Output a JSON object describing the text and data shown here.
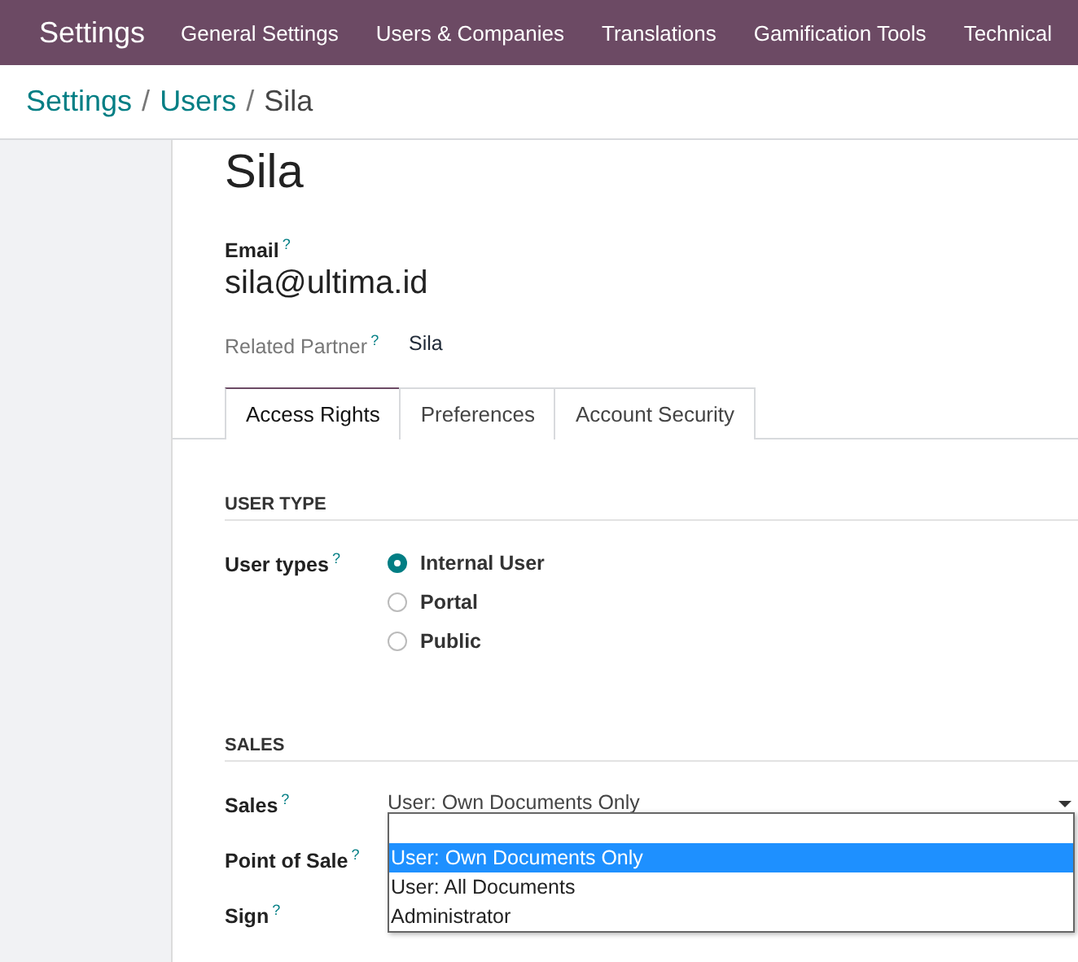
{
  "navbar": {
    "app": "Settings",
    "menu": [
      "General Settings",
      "Users & Companies",
      "Translations",
      "Gamification Tools",
      "Technical"
    ]
  },
  "breadcrumb": {
    "items": [
      "Settings",
      "Users",
      "Sila"
    ],
    "separators": [
      "/",
      "/"
    ]
  },
  "record": {
    "name": "Sila",
    "email_label": "Email",
    "email_help": "?",
    "email": "sila@ultima.id",
    "partner_label": "Related Partner",
    "partner_help": "?",
    "partner": "Sila"
  },
  "tabs": [
    {
      "label": "Access Rights",
      "selected": true
    },
    {
      "label": "Preferences",
      "selected": false
    },
    {
      "label": "Account Security",
      "selected": false
    }
  ],
  "sections": [
    {
      "title": "USER TYPE",
      "fields": [
        {
          "kind": "radio",
          "label": "User types",
          "help": "?",
          "options": [
            {
              "label": "Internal User",
              "selected": true
            },
            {
              "label": "Portal",
              "selected": false
            },
            {
              "label": "Public",
              "selected": false
            }
          ]
        }
      ]
    },
    {
      "title": "SALES",
      "fields": [
        {
          "kind": "select",
          "label": "Sales",
          "help": "?",
          "value": "User: Own Documents Only",
          "expanded": true,
          "options": [
            {
              "label": "User: Own Documents Only",
              "selected": true
            },
            {
              "label": "User: All Documents",
              "selected": false
            },
            {
              "label": "Administrator",
              "selected": false
            }
          ]
        },
        {
          "kind": "select",
          "label": "Point of Sale",
          "help": "?"
        },
        {
          "kind": "select",
          "label": "Sign",
          "help": "?"
        }
      ]
    }
  ]
}
